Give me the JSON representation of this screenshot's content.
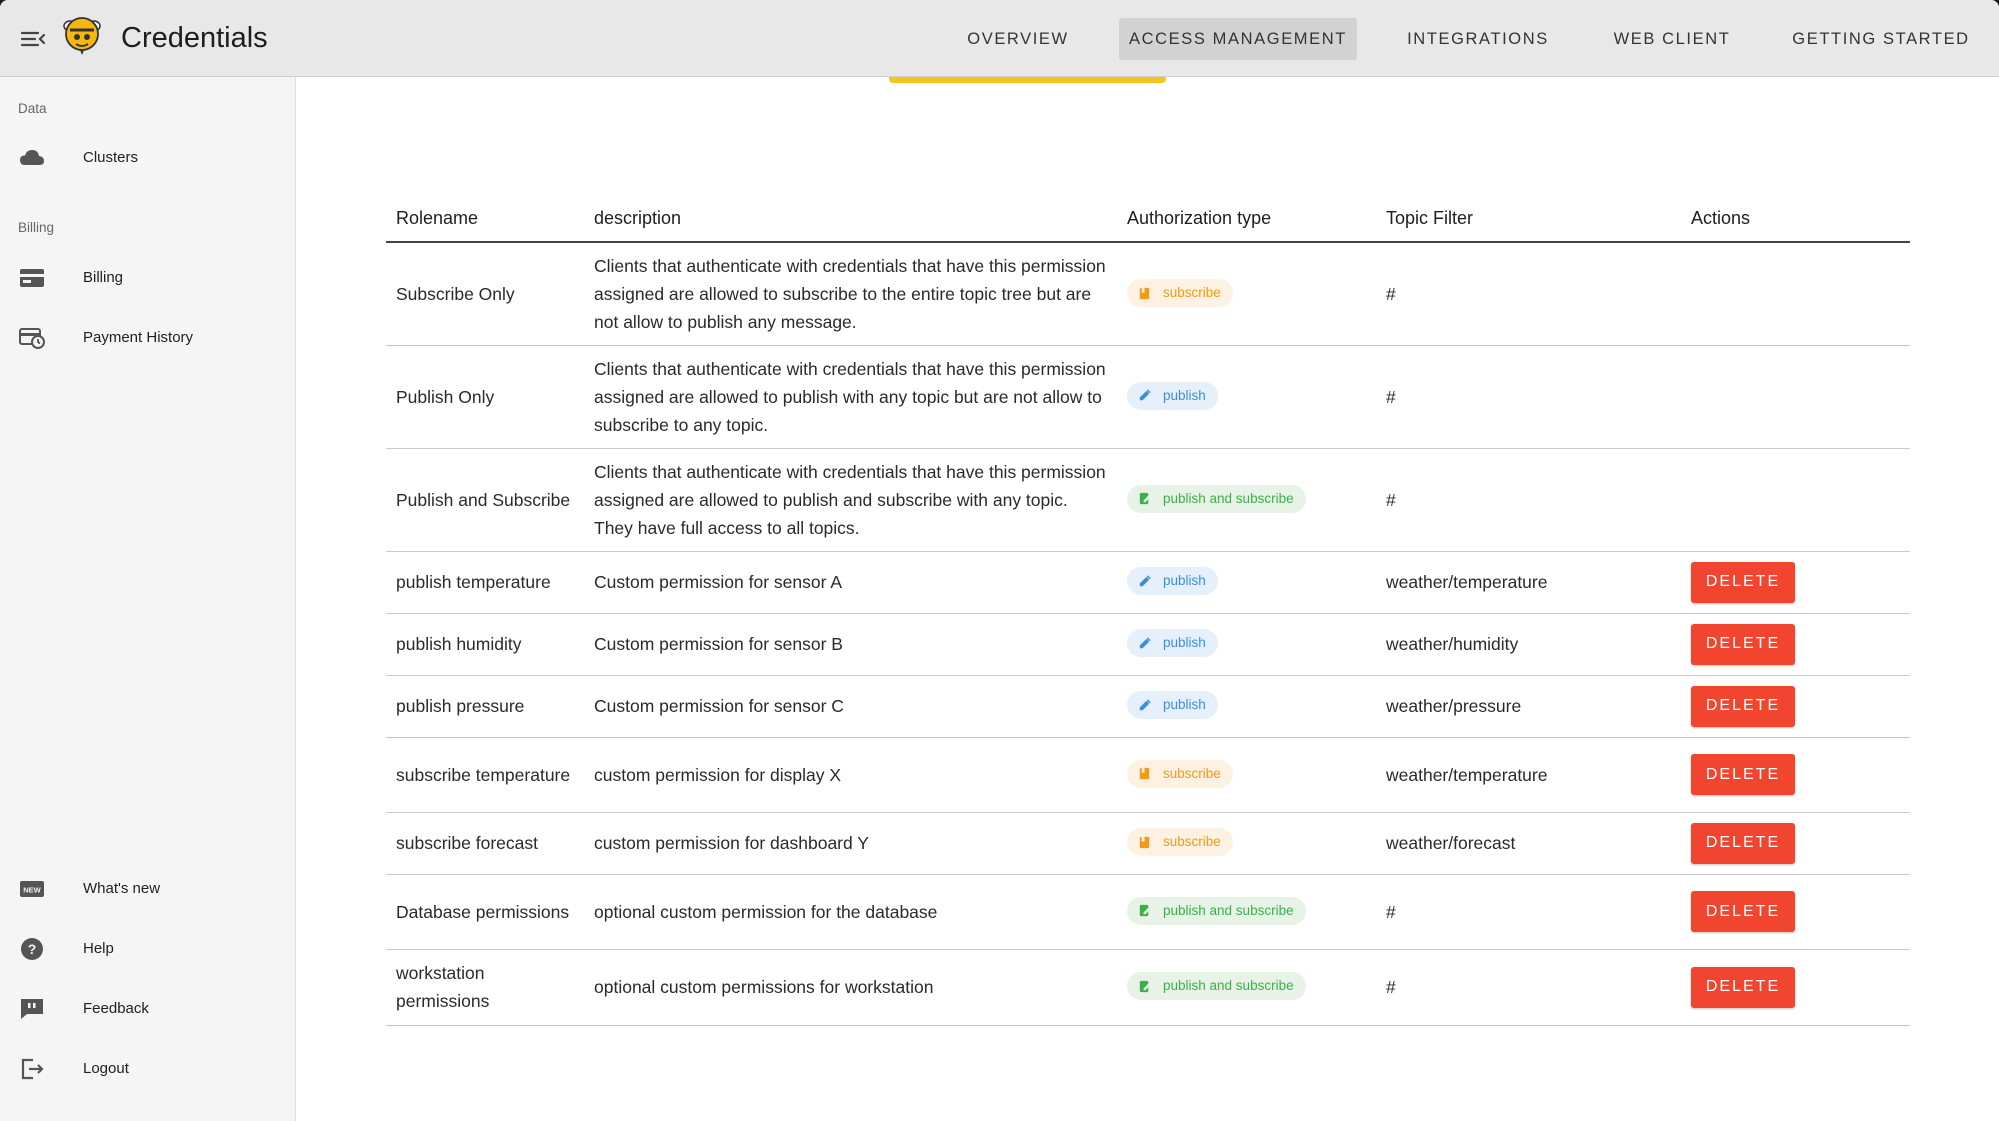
{
  "app": {
    "title": "Credentials"
  },
  "nav": [
    {
      "label": "OVERVIEW",
      "active": false
    },
    {
      "label": "ACCESS MANAGEMENT",
      "active": true
    },
    {
      "label": "INTEGRATIONS",
      "active": false
    },
    {
      "label": "WEB CLIENT",
      "active": false
    },
    {
      "label": "GETTING STARTED",
      "active": false
    }
  ],
  "sidebar": {
    "sections": [
      {
        "label": "Data"
      },
      {
        "label": "Billing"
      }
    ],
    "items": [
      {
        "label": "Clusters",
        "icon": "cloud-icon"
      },
      {
        "label": "Billing",
        "icon": "credit-card-icon"
      },
      {
        "label": "Payment History",
        "icon": "payment-history-icon"
      },
      {
        "label": "What's new",
        "icon": "new-badge-icon"
      },
      {
        "label": "Help",
        "icon": "help-icon"
      },
      {
        "label": "Feedback",
        "icon": "feedback-icon"
      },
      {
        "label": "Logout",
        "icon": "logout-icon"
      }
    ]
  },
  "table": {
    "headers": [
      "Rolename",
      "description",
      "Authorization type",
      "Topic Filter",
      "Actions"
    ],
    "delete_label": "DELETE",
    "rows": [
      {
        "rolename": "Subscribe Only",
        "description": "Clients that authenticate with credentials that have this permission assigned are allowed to subscribe to the entire topic tree but are not allow to publish any message.",
        "auth": "subscribe",
        "auth_kind": "sub",
        "topic": "#",
        "deletable": false
      },
      {
        "rolename": "Publish Only",
        "description": "Clients that authenticate with credentials that have this permission assigned are allowed to publish with any topic but are not allow to subscribe to any topic.",
        "auth": "publish",
        "auth_kind": "pub",
        "topic": "#",
        "deletable": false
      },
      {
        "rolename": "Publish and Subscribe",
        "description": "Clients that authenticate with credentials that have this permission assigned are allowed to publish and subscribe with any topic. They have full access to all topics.",
        "auth": "publish and subscribe",
        "auth_kind": "both",
        "topic": "#",
        "deletable": false
      },
      {
        "rolename": "publish temperature",
        "description": "Custom permission for sensor A",
        "auth": "publish",
        "auth_kind": "pub",
        "topic": "weather/temperature",
        "deletable": true
      },
      {
        "rolename": "publish humidity",
        "description": "Custom permission for sensor B",
        "auth": "publish",
        "auth_kind": "pub",
        "topic": "weather/humidity",
        "deletable": true
      },
      {
        "rolename": "publish pressure",
        "description": "Custom permission for sensor C",
        "auth": "publish",
        "auth_kind": "pub",
        "topic": "weather/pressure",
        "deletable": true
      },
      {
        "rolename": "subscribe temperature",
        "description": "custom permission for display X",
        "auth": "subscribe",
        "auth_kind": "sub",
        "topic": "weather/temperature",
        "deletable": true
      },
      {
        "rolename": "subscribe forecast",
        "description": "custom permission for dashboard Y",
        "auth": "subscribe",
        "auth_kind": "sub",
        "topic": "weather/forecast",
        "deletable": true
      },
      {
        "rolename": "Database permissions",
        "description": "optional custom permission for the database",
        "auth": "publish and subscribe",
        "auth_kind": "both",
        "topic": "#",
        "deletable": true
      },
      {
        "rolename": "workstation permissions",
        "description": "optional custom permissions for workstation",
        "auth": "publish and subscribe",
        "auth_kind": "both",
        "topic": "#",
        "deletable": true
      }
    ]
  },
  "colors": {
    "accent_yellow": "#f3c624",
    "delete_red": "#f1452f",
    "subscribe": "#f29a18",
    "publish": "#3b8ede",
    "both": "#3bb04a"
  }
}
